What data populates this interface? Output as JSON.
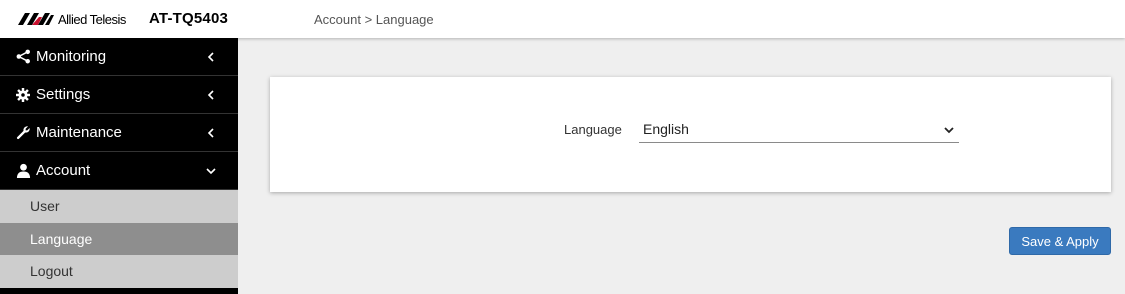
{
  "header": {
    "logo_text": "Allied Telesis",
    "model": "AT-TQ5403",
    "breadcrumb": "Account > Language"
  },
  "sidebar": {
    "items": [
      {
        "label": "Monitoring",
        "icon": "share-icon",
        "chevron": "chevron-left-icon"
      },
      {
        "label": "Settings",
        "icon": "gear-icon",
        "chevron": "chevron-left-icon"
      },
      {
        "label": "Maintenance",
        "icon": "wrench-icon",
        "chevron": "chevron-left-icon"
      },
      {
        "label": "Account",
        "icon": "user-icon",
        "chevron": "chevron-down-icon"
      }
    ],
    "account_submenu": [
      {
        "label": "User",
        "active": false
      },
      {
        "label": "Language",
        "active": true
      },
      {
        "label": "Logout",
        "active": false
      }
    ]
  },
  "form": {
    "language_label": "Language",
    "language_value": "English"
  },
  "actions": {
    "save_label": "Save & Apply"
  },
  "colors": {
    "sidebar_bg": "#000000",
    "submenu_bg": "#cdcdcd",
    "submenu_active_bg": "#8e8e8e",
    "primary_button": "#3a7abf",
    "content_bg": "#efefef"
  }
}
